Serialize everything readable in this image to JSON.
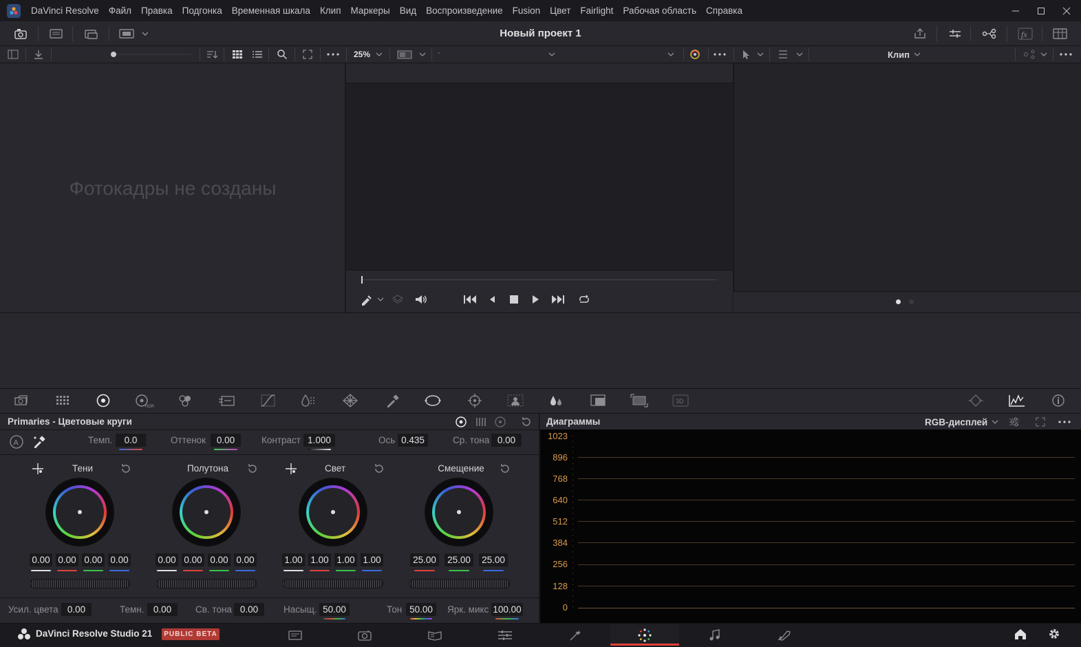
{
  "app": {
    "name": "DaVinci Resolve",
    "project_title": "Новый проект 1"
  },
  "menu": [
    "Файл",
    "Правка",
    "Подгонка",
    "Временная шкала",
    "Клип",
    "Маркеры",
    "Вид",
    "Воспроизведение",
    "Fusion",
    "Цвет",
    "Fairlight",
    "Рабочая область",
    "Справка"
  ],
  "viewer": {
    "zoom": "25%",
    "clip_label": "Клип"
  },
  "gallery": {
    "empty_text": "Фотокадры не созданы"
  },
  "primaries": {
    "title": "Primaries - Цветовые круги",
    "top_controls": [
      {
        "label": "Темп.",
        "value": "0.0"
      },
      {
        "label": "Оттенок",
        "value": "0.00"
      },
      {
        "label": "Контраст",
        "value": "1.000"
      },
      {
        "label": "Ось",
        "value": "0.435"
      },
      {
        "label": "Ср. тона",
        "value": "0.00"
      }
    ],
    "wheels": [
      {
        "name": "Тени",
        "values": [
          "0.00",
          "0.00",
          "0.00",
          "0.00"
        ]
      },
      {
        "name": "Полутона",
        "values": [
          "0.00",
          "0.00",
          "0.00",
          "0.00"
        ]
      },
      {
        "name": "Свет",
        "values": [
          "1.00",
          "1.00",
          "1.00",
          "1.00"
        ]
      },
      {
        "name": "Смещение",
        "values": [
          "25.00",
          "25.00",
          "25.00"
        ]
      }
    ],
    "bottom_controls": [
      {
        "label": "Усил. цвета",
        "value": "0.00"
      },
      {
        "label": "Темн.",
        "value": "0.00"
      },
      {
        "label": "Св. тона",
        "value": "0.00"
      },
      {
        "label": "Насыщ.",
        "value": "50.00"
      },
      {
        "label": "Тон",
        "value": "50.00"
      },
      {
        "label": "Ярк. микс",
        "value": "100.00"
      }
    ]
  },
  "scopes": {
    "title": "Диаграммы",
    "mode": "RGB-дисплей",
    "y_ticks": [
      "1023",
      "896",
      "768",
      "640",
      "512",
      "384",
      "256",
      "128",
      "0"
    ]
  },
  "bottom": {
    "brand": "DaVinci Resolve Studio 21",
    "badge": "PUBLIC BETA"
  },
  "colors": {
    "accent_red": "#e0423a",
    "scope_label": "#d89a48",
    "badge_bg": "#b23a34"
  }
}
